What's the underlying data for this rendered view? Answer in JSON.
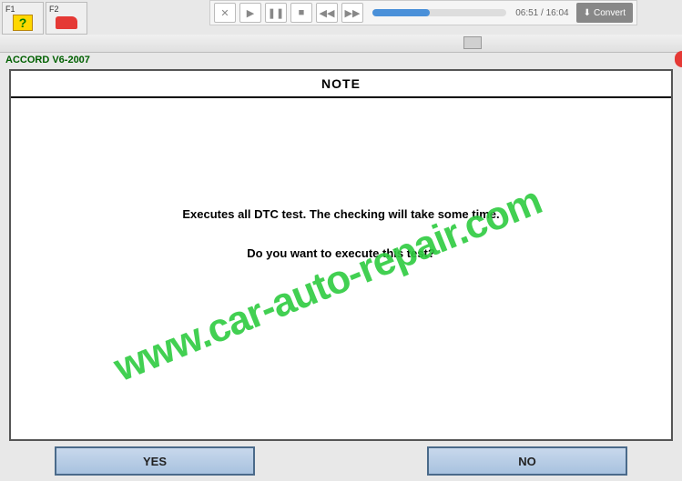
{
  "player": {
    "time": "06:51 / 16:04",
    "convert_label": "Convert"
  },
  "tabs": {
    "f1_label": "F1",
    "f2_label": "F2"
  },
  "breadcrumb": "ACCORD V6-2007",
  "panel": {
    "header": "NOTE",
    "line1": "Executes all DTC test. The checking will take some time.",
    "line2": "Do you want to execute this test?"
  },
  "buttons": {
    "yes": "YES",
    "no": "NO"
  },
  "watermark": "www.car-auto-repair.com"
}
